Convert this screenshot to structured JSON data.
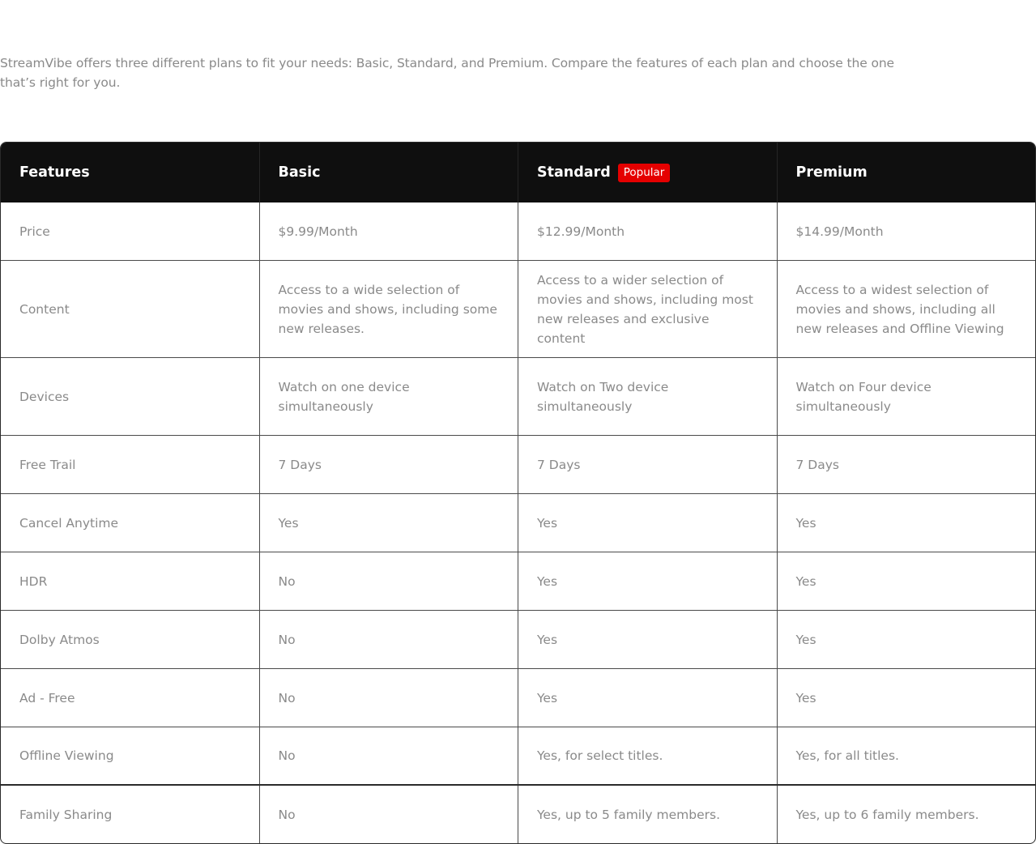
{
  "intro": {
    "text": "StreamVibe offers three different plans to fit your needs: Basic, Standard, and Premium. Compare the features of each plan and choose the one that’s right for you."
  },
  "table": {
    "headers": {
      "features": "Features",
      "basic": "Basic",
      "standard": "Standard",
      "standard_badge": "Popular",
      "premium": "Premium"
    },
    "rows": [
      {
        "feature": "Price",
        "basic": "$9.99/Month",
        "standard": "$12.99/Month",
        "premium": "$14.99/Month"
      },
      {
        "feature": "Content",
        "basic": "Access to a wide selection of movies and shows, including some new releases.",
        "standard": "Access to a wider selection of movies and shows, including most new releases and exclusive content",
        "premium": "Access to a widest selection of movies and shows, including all new releases and Offline Viewing"
      },
      {
        "feature": "Devices",
        "basic": "Watch on one device simultaneously",
        "standard": "Watch on Two device simultaneously",
        "premium": "Watch on Four device simultaneously"
      },
      {
        "feature": "Free Trail",
        "basic": "7 Days",
        "standard": "7 Days",
        "premium": "7 Days"
      },
      {
        "feature": "Cancel Anytime",
        "basic": "Yes",
        "standard": "Yes",
        "premium": "Yes"
      },
      {
        "feature": "HDR",
        "basic": "No",
        "standard": "Yes",
        "premium": "Yes"
      },
      {
        "feature": "Dolby Atmos",
        "basic": "No",
        "standard": "Yes",
        "premium": "Yes"
      },
      {
        "feature": "Ad - Free",
        "basic": "No",
        "standard": "Yes",
        "premium": "Yes"
      },
      {
        "feature": "Offline Viewing",
        "basic": "No",
        "standard": "Yes, for select titles.",
        "premium": "Yes, for all titles."
      },
      {
        "feature": "Family Sharing",
        "basic": "No",
        "standard": "Yes, up to 5 family members.",
        "premium": "Yes, up to 6 family members."
      }
    ]
  },
  "colors": {
    "header_bg": "#0f0f0f",
    "badge_bg": "#e50000",
    "text_muted": "#8a8a8a",
    "grid_line": "#4a4a4a"
  }
}
